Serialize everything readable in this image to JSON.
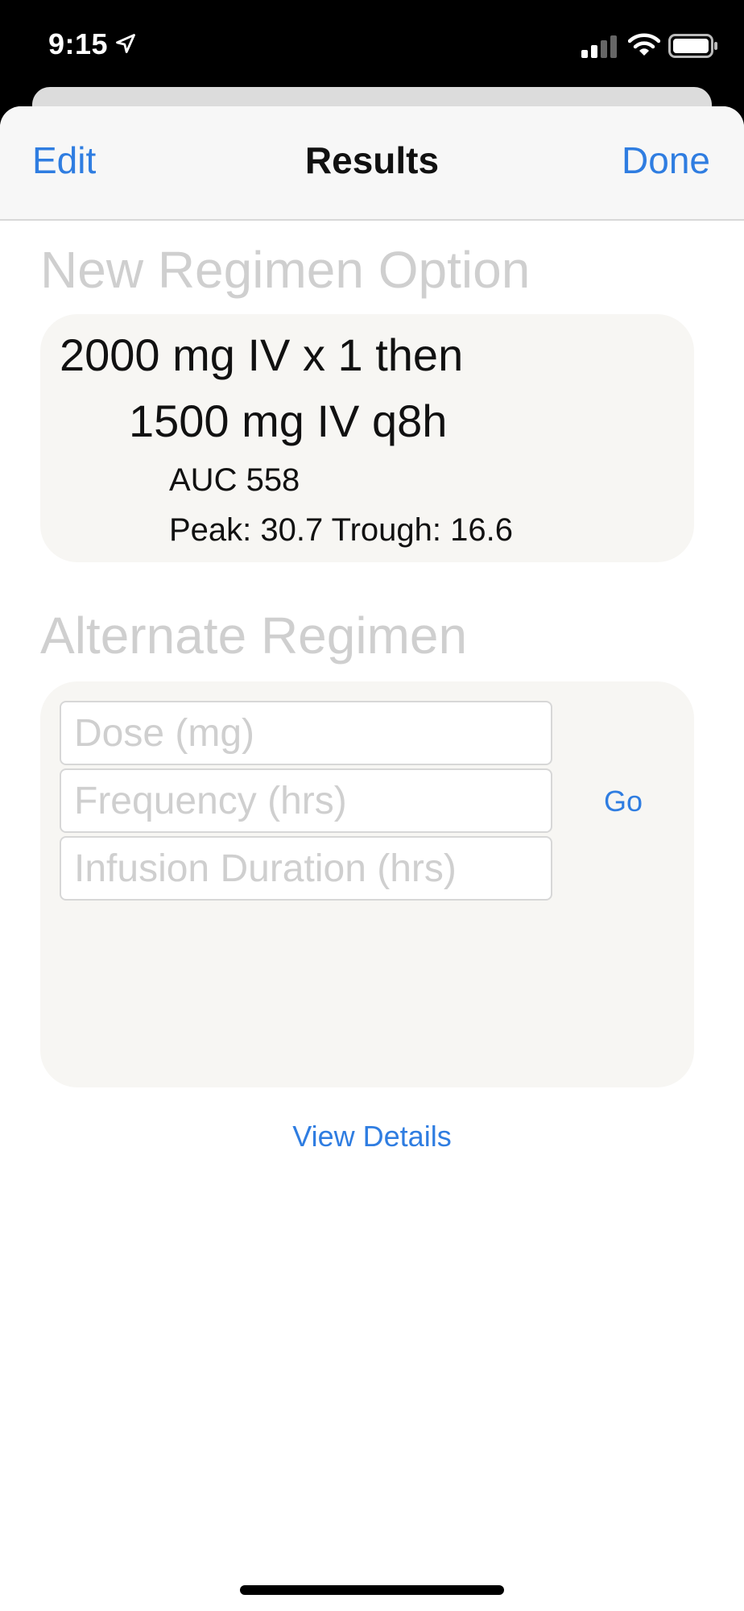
{
  "status_bar": {
    "time": "9:15",
    "icons": [
      "location-arrow-icon",
      "cellular-signal-icon",
      "wifi-icon",
      "battery-icon"
    ]
  },
  "nav": {
    "left_label": "Edit",
    "title": "Results",
    "right_label": "Done"
  },
  "new_regimen": {
    "section_title": "New Regimen Option",
    "line1": "2000 mg IV x 1 then",
    "line2": "1500 mg IV q8h",
    "auc": "AUC 558",
    "peak_trough": "Peak: 30.7 Trough: 16.6"
  },
  "alternate_regimen": {
    "section_title": "Alternate Regimen",
    "dose_placeholder": "Dose (mg)",
    "frequency_placeholder": "Frequency (hrs)",
    "infusion_placeholder": "Infusion Duration (hrs)",
    "go_label": "Go"
  },
  "view_details_label": "View Details",
  "colors": {
    "accent": "#2f7de1",
    "card_background": "#f7f6f3",
    "section_title": "#cfcfcf"
  }
}
